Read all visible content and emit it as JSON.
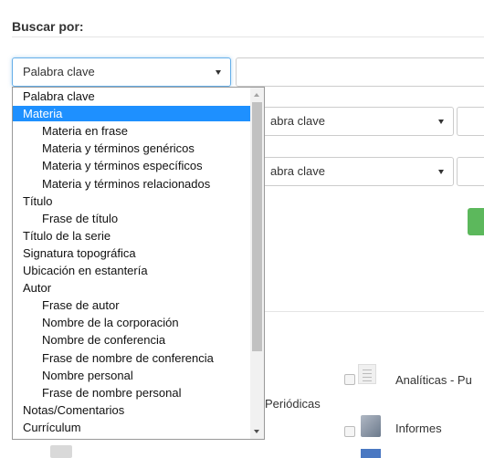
{
  "search": {
    "title": "Buscar por:",
    "field_select_value": "Palabra clave",
    "row2_select_value": "abra clave",
    "row3_select_value": "abra clave"
  },
  "dropdown": {
    "options": [
      {
        "label": "Palabra clave",
        "level": 0
      },
      {
        "label": "Materia",
        "level": 0,
        "selected": true
      },
      {
        "label": "Materia en frase",
        "level": 1
      },
      {
        "label": "Materia y términos genéricos",
        "level": 1
      },
      {
        "label": "Materia y términos específicos",
        "level": 1
      },
      {
        "label": "Materia y términos relacionados",
        "level": 1
      },
      {
        "label": "Título",
        "level": 0
      },
      {
        "label": "Frase de título",
        "level": 1
      },
      {
        "label": "Título de la serie",
        "level": 0
      },
      {
        "label": "Signatura topográfica",
        "level": 0
      },
      {
        "label": "Ubicación en estantería",
        "level": 0
      },
      {
        "label": "Autor",
        "level": 0
      },
      {
        "label": "Frase de autor",
        "level": 1
      },
      {
        "label": "Nombre de la corporación",
        "level": 1
      },
      {
        "label": "Nombre de conferencia",
        "level": 1
      },
      {
        "label": "Frase de nombre de conferencia",
        "level": 1
      },
      {
        "label": "Nombre personal",
        "level": 1
      },
      {
        "label": "Frase de nombre personal",
        "level": 1
      },
      {
        "label": "Notas/Comentarios",
        "level": 0
      },
      {
        "label": "Currículum",
        "level": 0
      }
    ]
  },
  "item_types": {
    "analiticas_label": "Analíticas - Pu",
    "periodicas_label": "Periódicas",
    "informes_label": "Informes"
  },
  "colors": {
    "selected_bg": "#1e90ff",
    "focus_border": "#66afe9",
    "green_button": "#5cb85c"
  }
}
